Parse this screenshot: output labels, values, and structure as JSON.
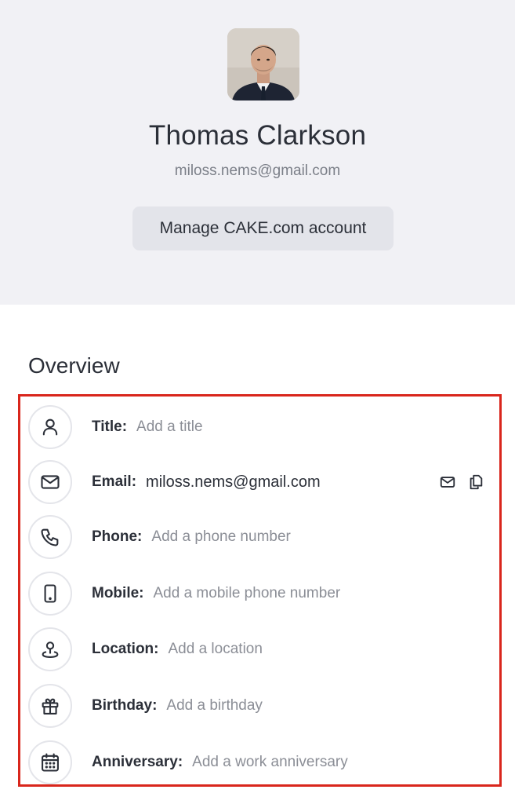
{
  "profile": {
    "name": "Thomas Clarkson",
    "email": "miloss.nems@gmail.com",
    "manage_label": "Manage CAKE.com account"
  },
  "overview": {
    "title": "Overview",
    "rows": [
      {
        "label": "Title:",
        "value": "Add a title",
        "icon": "person-icon"
      },
      {
        "label": "Email:",
        "value": "miloss.nems@gmail.com",
        "icon": "envelope-icon"
      },
      {
        "label": "Phone:",
        "value": "Add a phone number",
        "icon": "phone-icon"
      },
      {
        "label": "Mobile:",
        "value": "Add a mobile phone number",
        "icon": "mobile-icon"
      },
      {
        "label": "Location:",
        "value": "Add a location",
        "icon": "location-pin-icon"
      },
      {
        "label": "Birthday:",
        "value": "Add a birthday",
        "icon": "gift-icon"
      },
      {
        "label": "Anniversary:",
        "value": "Add a work anniversary",
        "icon": "calendar-icon"
      }
    ],
    "email_actions": [
      "send-email-icon",
      "copy-icon"
    ]
  },
  "colors": {
    "header_bg": "#f1f1f5",
    "button_bg": "#e3e4ea",
    "highlight_border": "#d9261c",
    "placeholder_text": "#8b8e96"
  }
}
